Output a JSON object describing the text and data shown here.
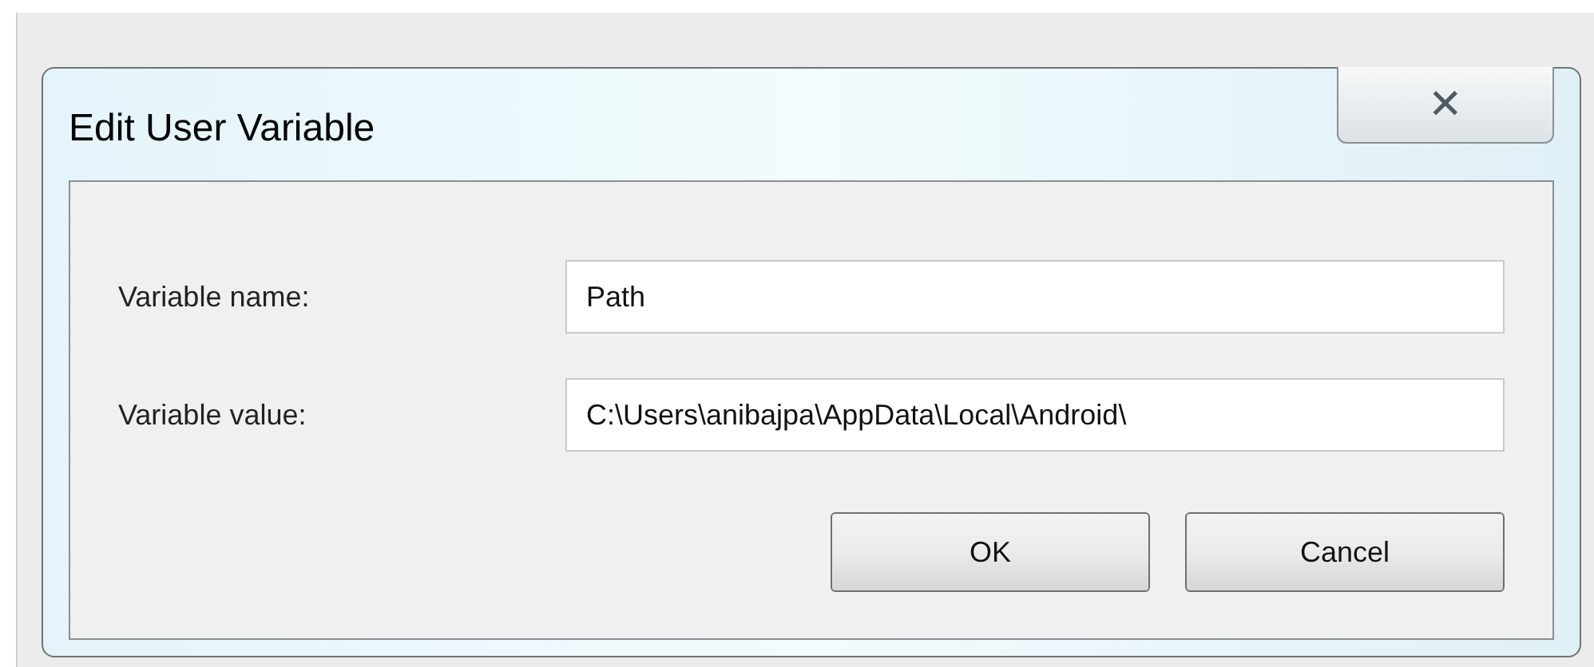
{
  "window": {
    "title": "Edit User Variable",
    "close_icon": "✕"
  },
  "fields": [
    {
      "label": "Variable name:",
      "value": "Path"
    },
    {
      "label": "Variable value:",
      "value": "C:\\Users\\anibajpa\\AppData\\Local\\Android\\"
    }
  ],
  "buttons": [
    "OK",
    "Cancel"
  ]
}
